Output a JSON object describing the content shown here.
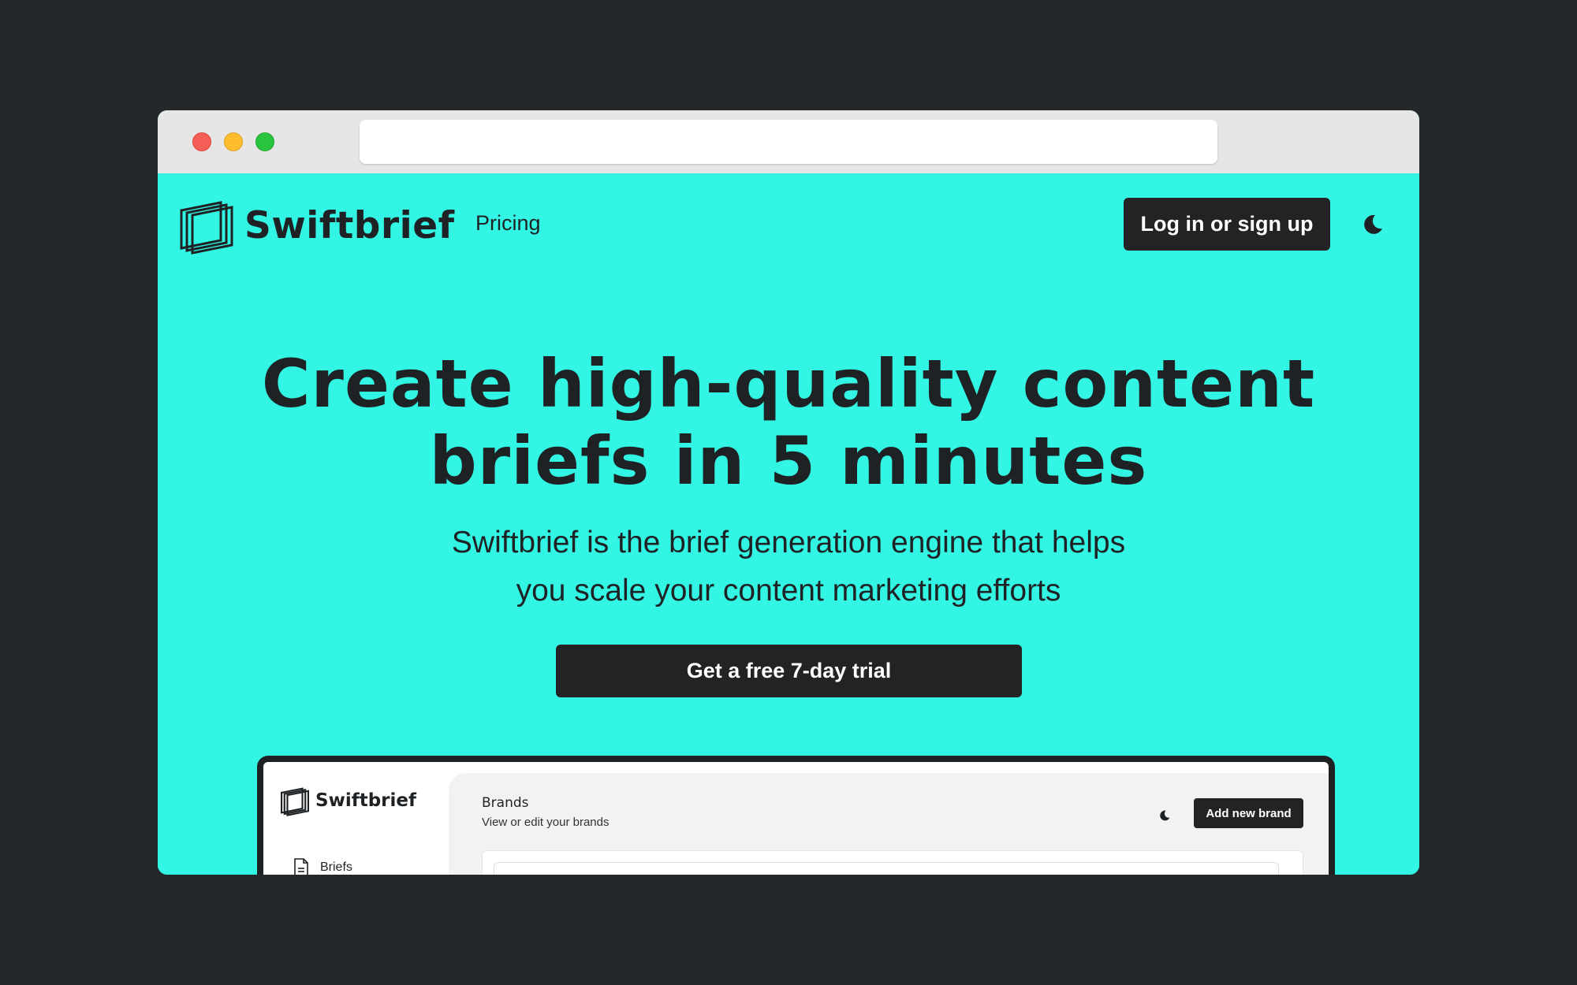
{
  "site": {
    "brand_name": "Swiftbrief",
    "nav": {
      "pricing": "Pricing"
    },
    "login_button": "Log in or sign up",
    "hero": {
      "title_line1": "Create high-quality content",
      "title_line2": "briefs in 5 minutes",
      "sub_line1": "Swiftbrief is the brief generation engine that helps",
      "sub_line2": "you scale your content marketing efforts",
      "cta": "Get a free 7-day trial"
    }
  },
  "app_preview": {
    "brand_name": "Swiftbrief",
    "nav_items": [
      {
        "label": "Briefs",
        "icon": "document-icon"
      }
    ],
    "header": {
      "title": "Brands",
      "subtitle": "View or edit your brands",
      "add_button": "Add new brand"
    }
  },
  "colors": {
    "background": "#24282a",
    "accent": "#33f5e3",
    "dark": "#222324"
  },
  "icons": [
    "window-close-dot",
    "window-minimize-dot",
    "window-maximize-dot",
    "logo-icon",
    "moon-icon",
    "document-icon"
  ]
}
